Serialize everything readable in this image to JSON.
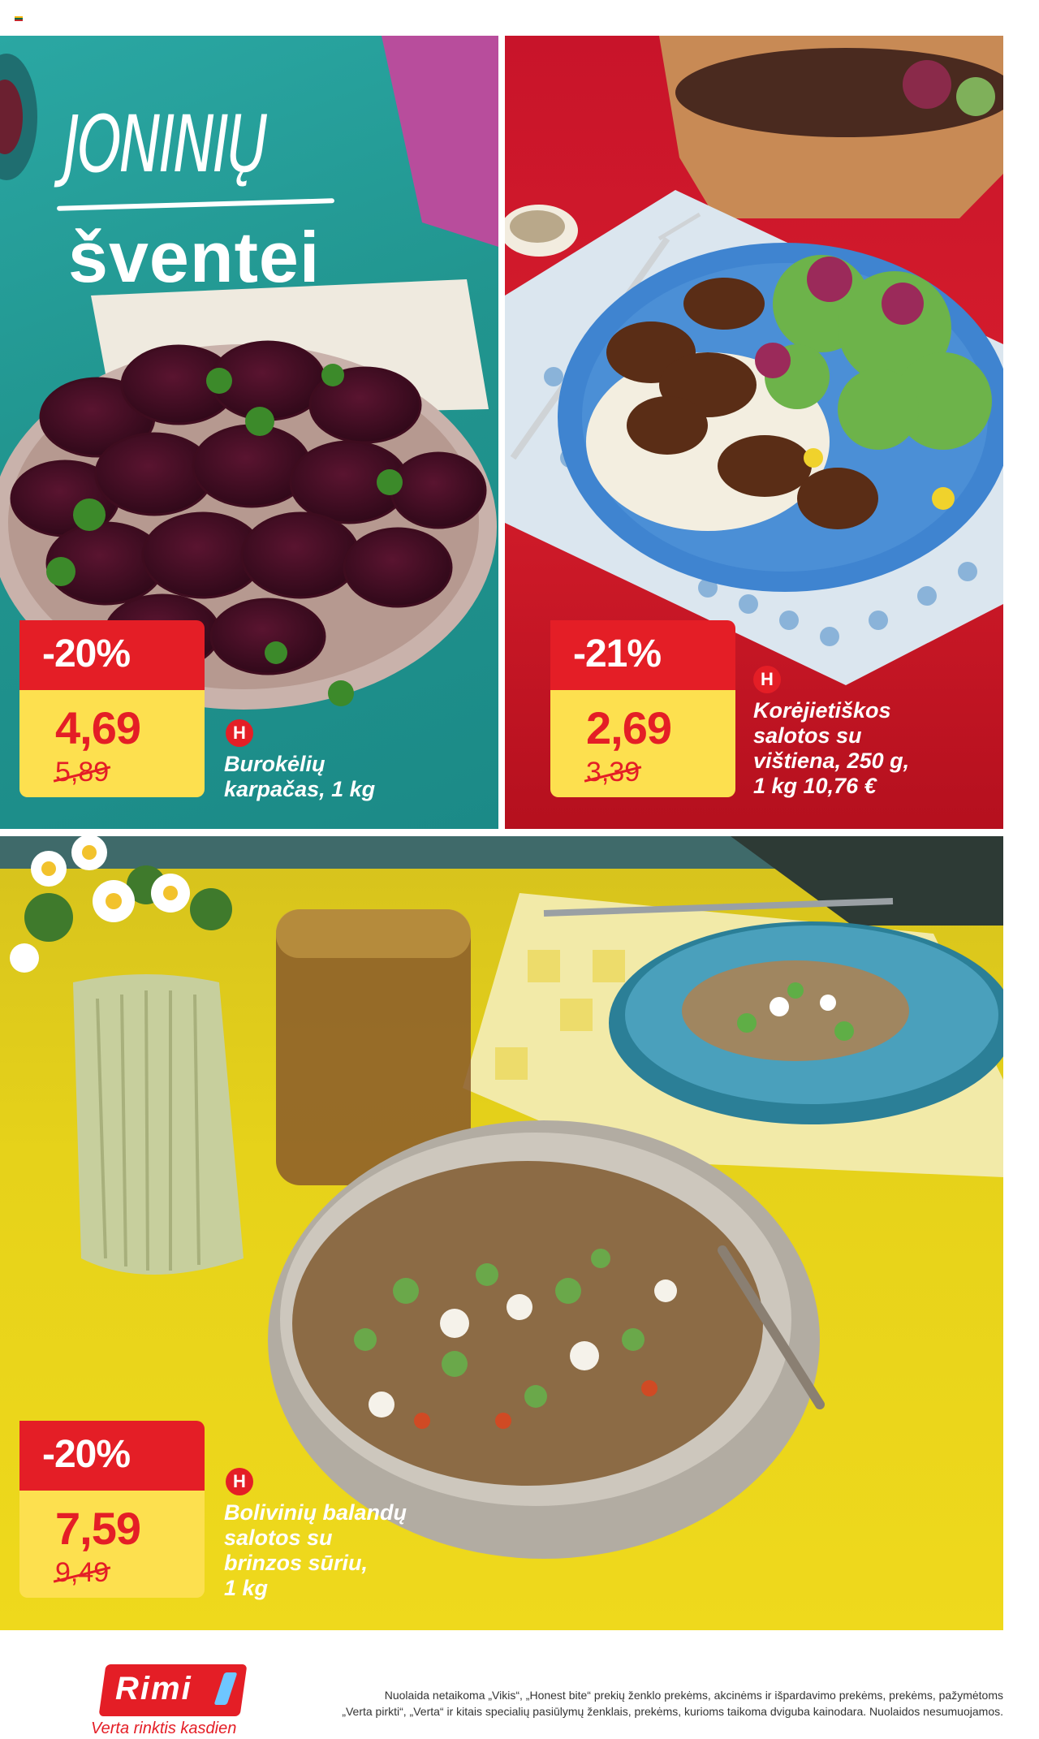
{
  "colors": {
    "brand_red": "#e41e26",
    "price_yellow": "#fde04f",
    "teal_background": "#2aa7a3",
    "red_background": "#d61d2c",
    "yellow_background": "#e6d21a",
    "white": "#ffffff"
  },
  "title": {
    "line1": "JONINIŲ",
    "line2": "šventei"
  },
  "offers": [
    {
      "discount": "-20%",
      "price": "4,69",
      "old_price": "5,89",
      "badge_icon": "H",
      "name_line1": "Burokėlių",
      "name_line2": "karpačas, 1 kg"
    },
    {
      "discount": "-21%",
      "price": "2,69",
      "old_price": "3,39",
      "badge_icon": "H",
      "name_line1": "Korėjietiškos",
      "name_line2": "salotos su",
      "name_line3": "vištiena, 250 g,",
      "name_line4": "1 kg 10,76 €"
    },
    {
      "discount": "-20%",
      "price": "7,59",
      "old_price": "9,49",
      "badge_icon": "H",
      "name_line1": "Bolivinių balandų",
      "name_line2": "salotos su",
      "name_line3": "brinzos sūriu,",
      "name_line4": "1 kg"
    }
  ],
  "footer": {
    "logo_text": "Rimi",
    "slogan": "Verta rinktis kasdien",
    "note_line1": "Nuolaida netaikoma „Vikis“, „Honest bite“ prekių ženklo prekėms, akcinėms ir išpardavimo prekėms, prekėms, pažymėtoms",
    "note_line2": "„Verta pirkti“, „Verta“ ir kitais specialių pasiūlymų ženklais, prekėms, kurioms taikoma dviguba kainodara. Nuolaidos nesumuojamos."
  },
  "icons": [
    "lithuanian-flag-icon",
    "beetroot-plate-image",
    "korean-salad-plate-image",
    "quinoa-salad-bowl-image",
    "flower-vase-image",
    "drink-glass-image",
    "rimi-logo"
  ]
}
